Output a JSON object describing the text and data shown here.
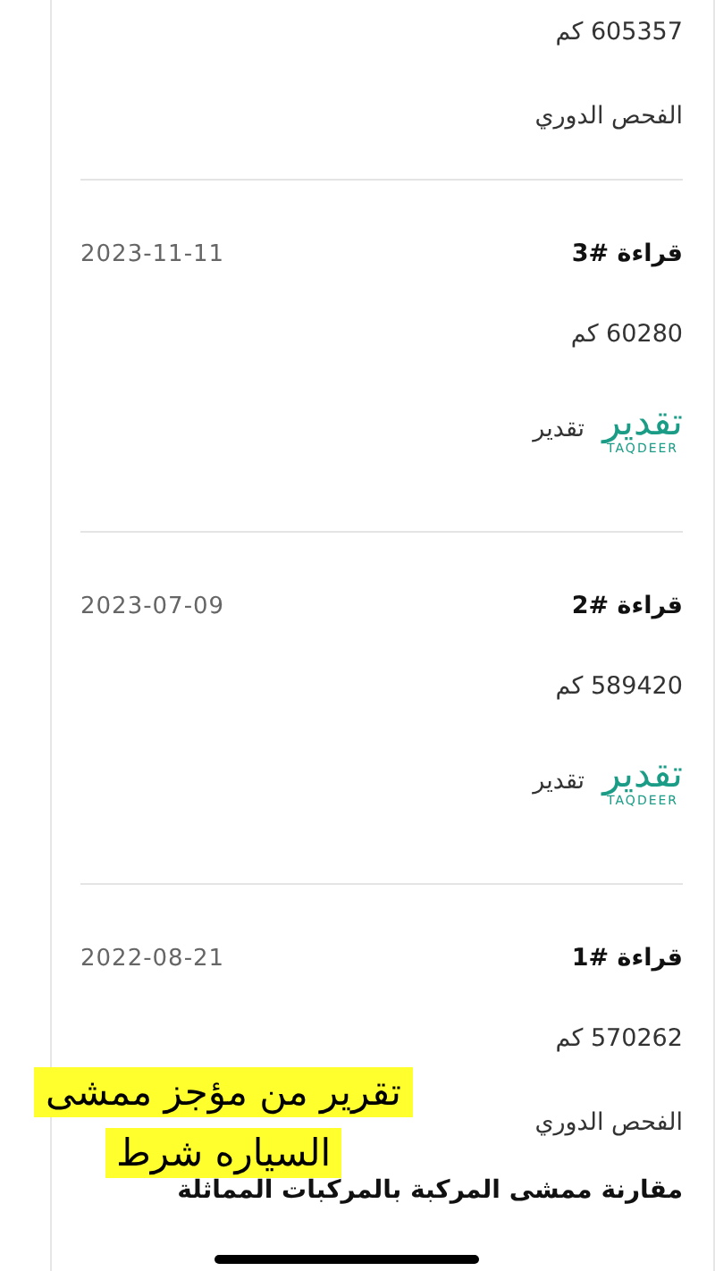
{
  "top_entry": {
    "odometer": "605357 كم",
    "source": {
      "kind": "text",
      "label": "الفحص الدوري"
    }
  },
  "readings": [
    {
      "title": "قراءة #3",
      "date": "2023-11-11",
      "odometer": "60280 كم",
      "source": {
        "kind": "taqdeer",
        "logo_text": "تقدير",
        "logo_subtext": "TAQDEER",
        "label": "تقدير"
      }
    },
    {
      "title": "قراءة #2",
      "date": "2023-07-09",
      "odometer": "589420 كم",
      "source": {
        "kind": "taqdeer",
        "logo_text": "تقدير",
        "logo_subtext": "TAQDEER",
        "label": "تقدير"
      }
    },
    {
      "title": "قراءة #1",
      "date": "2022-08-21",
      "odometer": "570262 كم",
      "source": {
        "kind": "text",
        "label": "الفحص الدوري"
      }
    }
  ],
  "section_heading": "مقارنة ممشى المركبة بالمركبات المماثلة",
  "annotation": {
    "lines": [
      "تقرير من مؤجز ممشى",
      "السياره شرط"
    ]
  }
}
